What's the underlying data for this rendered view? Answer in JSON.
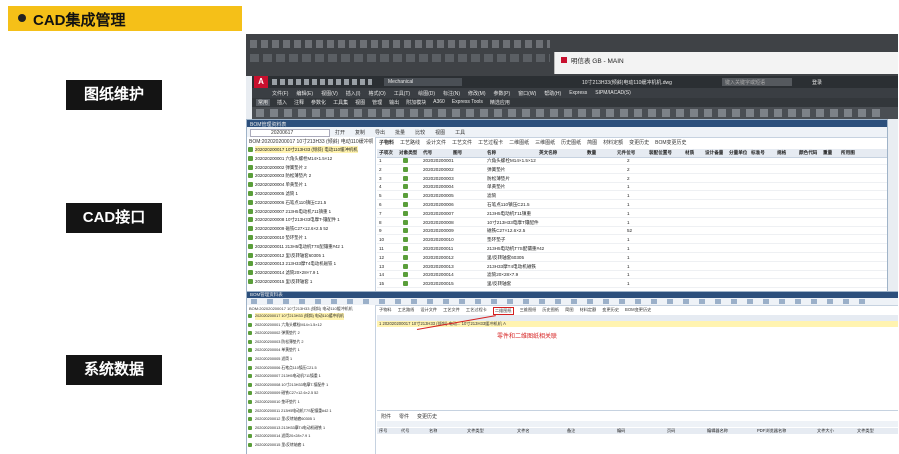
{
  "header": {
    "title": "CAD集成管理"
  },
  "labels": [
    "图纸维护",
    "CAD接口",
    "系统数据"
  ],
  "cad": {
    "title": "10寸213H33(倾斜)电动110缓冲机机.dwg",
    "search_placeholder": "键入关键字或短语",
    "login": "登录",
    "workspace": "Mechanical",
    "menus": [
      "文件(F)",
      "编辑(E)",
      "视图(V)",
      "插入(I)",
      "格式(O)",
      "工具(T)",
      "绘图(D)",
      "标注(N)",
      "修改(M)",
      "参数(P)",
      "窗口(W)",
      "帮助(H)",
      "Express",
      "SIPM/IACAD(S)"
    ],
    "ribbon_tabs": [
      "常用",
      "插入",
      "注释",
      "参数化",
      "工具集",
      "视图",
      "管理",
      "输出",
      "附加模块",
      "A360",
      "Express Tools",
      "精选应用"
    ],
    "side_window": "明信表 GB - MAIN"
  },
  "bom_upper": {
    "title": "BOM管理资料表",
    "date": "20200617",
    "toolbar": [
      "打开",
      "复制",
      "导出",
      "批量",
      "比较",
      "视图",
      "工具"
    ],
    "tabs": [
      "子物料",
      "工艺路线",
      "设计文件",
      "工艺文件",
      "工艺过程卡",
      "二维图纸",
      "三维图纸",
      "历史图纸",
      "简图",
      "材料定额",
      "变更历史",
      "BOM变更历史"
    ],
    "root": "BOM:202020200017 10寸213H33 (倾斜) 电动110缓冲机机",
    "tree": [
      "202020200017 10寸213H33 (倾斜) 电动110缓冲机机",
      "202020200001 六角头螺栓M14×1.5×12",
      "202020200002 弹簧垫片 2",
      "202020200003 防松薄垫片 2",
      "202020200004 单黄垫片 1",
      "202020200005 滤筒 1",
      "202020200006 石笔点110镇压C21.5",
      "202020200007 213H5电动机711镇重 1",
      "202020200008 10寸213H33电摩T-镶配件 1",
      "202020200009 磁铁C27×12.6×2.5 52",
      "202020200010 垫环垫片 1",
      "202020200011 213H5电动机T7S配镶重#42 1",
      "202020200012 里/反转轴套60305 1",
      "202020200013 213H33摩T4电动机磁铁 1",
      "202020200014 滤筒20×28×7.9 1",
      "202020200015 里/反转轴套 1"
    ],
    "columns": [
      "子项次",
      "对象类型",
      "代号",
      "图号",
      "名称",
      "英文名称",
      "数量",
      "元件位号",
      "装配位置号",
      "材质",
      "设计备量",
      "分量单位",
      "标准号",
      "规格",
      "颜色代码",
      "重量",
      "所用图"
    ],
    "rows": [
      [
        "1",
        "202020200001",
        "六角头螺栓M14×1.5×12",
        "2"
      ],
      [
        "2",
        "202020200002",
        "弹簧垫片",
        "2"
      ],
      [
        "3",
        "202020200003",
        "防松薄垫片",
        "2"
      ],
      [
        "4",
        "202020200004",
        "单黄垫片",
        "1"
      ],
      [
        "5",
        "202020200005",
        "滤筒",
        "1"
      ],
      [
        "6",
        "202020200006",
        "石笔点110镇压C21.5",
        "1"
      ],
      [
        "7",
        "202020200007",
        "213H5电动机T11镇重",
        "1"
      ],
      [
        "8",
        "202020200008",
        "10寸213H33电摩T镶配件",
        "1"
      ],
      [
        "9",
        "202020200009",
        "磁铁C27×12.6×2.5",
        "52"
      ],
      [
        "10",
        "202020200010",
        "垫环垫子",
        "1"
      ],
      [
        "11",
        "202020200011",
        "213H5电动机T7S配镶重#42",
        "1"
      ],
      [
        "12",
        "202020200012",
        "里/反转轴套60305",
        "1"
      ],
      [
        "13",
        "202020200013",
        "213H33摩T4电动机磁铁",
        "1"
      ],
      [
        "14",
        "202020200014",
        "滤筒20×28×7.9",
        "1"
      ],
      [
        "15",
        "202020200015",
        "里/反转轴套",
        "1"
      ]
    ]
  },
  "bom_lower": {
    "title": "BOM管理资料表",
    "root": "BOM:202020200017 10寸213H33 (倾斜) 电动110缓冲机机",
    "row_text": "1  202020200017  10寸213H33 (倾斜) 电动...  10寸213H33缓冲机机  A",
    "annotation": "零件和二维图纸相关联",
    "bottom_tabs": [
      "附件",
      "零件",
      "变更历史"
    ],
    "bottom_columns": [
      "序号",
      "代号",
      "名称",
      "文件类型",
      "文件名",
      "备注",
      "编码",
      "页码",
      "编辑器名称",
      "PDF浏览器名称",
      "文件大小",
      "文件类型"
    ]
  },
  "colors": {
    "accent": "#f5c018",
    "label_bg": "#141414",
    "cad_red": "#c8102e",
    "highlight": "#fff3b0"
  }
}
